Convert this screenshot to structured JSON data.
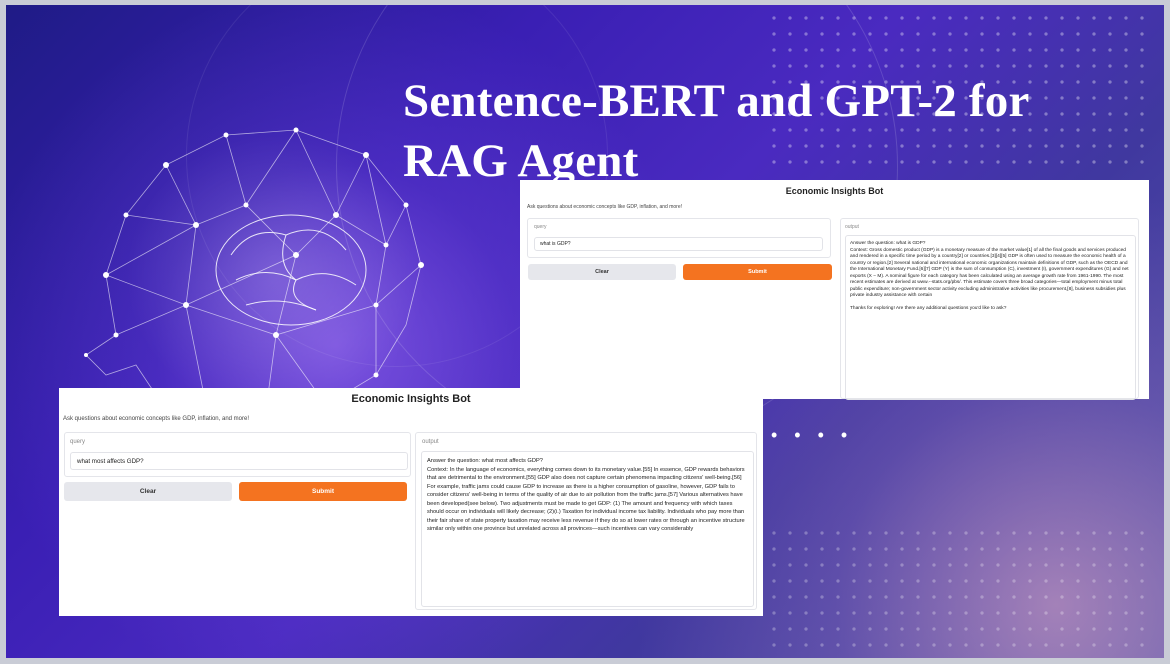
{
  "slide": {
    "title": "Sentence-BERT and GPT-2 for\nRAG Agent",
    "ellipsis": "• • • •",
    "colors": {
      "background": "#3a1fb4",
      "accent": "#f47320",
      "title": "#ffffff"
    }
  },
  "app_top": {
    "title": "Economic Insights Bot",
    "subtitle": "Ask questions about economic concepts like GDP, inflation, and more!",
    "query_label": "query",
    "query_value": "what is GDP?",
    "clear_label": "Clear",
    "submit_label": "Submit",
    "output_label": "output",
    "output_text": "Answer the question: what is GDP?\nContext: Gross domestic product (GDP) is a monetary measure of the market value[1] of all the final goods and services produced and rendered in a specific time period by a country[2] or countries.[3][4][5] GDP is often used to measure the economic health of a country or region.[2] Several national and international economic organizations maintain definitions of GDP, such as the OECD and the International Monetary Fund.[6][7] GDP (Y) is the sum of consumption (C), investment (I), government expenditures (G) and net exports (X − M). A nominal figure for each category has been calculated using an average growth rate from 1961-1990. The most recent estimates are derived at www.--stats.org/pbs/. This estimate covers three broad categories—total employment minus total public expenditure; non-government sector activity excluding administrative activities like procurement,[8], business subsidies plus private industry assistance with certain\n\nThanks for exploring! Are there any additional questions you'd like to ask?"
  },
  "app_bottom": {
    "title": "Economic Insights Bot",
    "subtitle": "Ask questions about economic concepts like GDP, inflation, and more!",
    "query_label": "query",
    "query_value": "what most affects GDP?",
    "clear_label": "Clear",
    "submit_label": "Submit",
    "output_label": "output",
    "output_text": "Answer the question: what most affects GDP?\nContext: In the language of economics, everything comes down to its monetary value.[55] In essence, GDP rewards behaviors that are detrimental to the environment.[55] GDP also does not capture certain phenomena impacting citizens' well-being.[56] For example, traffic jams could cause GDP to increase as there is a higher consumption of gasoline, however, GDP fails to consider citizens' well-being in terms of the quality of air due to air pollution from the traffic jams.[57] Various alternatives have been developed(see below). Two adjustments must be made to get GDP: (1) The amount and frequency with which taxes should occur on individuals will likely decrease; (2)(i.) Taxation for individual income tax liability. Individuals who pay more than their fair share of state property taxation may receive less revenue if they do so at lower rates or through an incentive structure similar only within one province but unrelated across all provinces—such incentives can vary considerably"
  }
}
